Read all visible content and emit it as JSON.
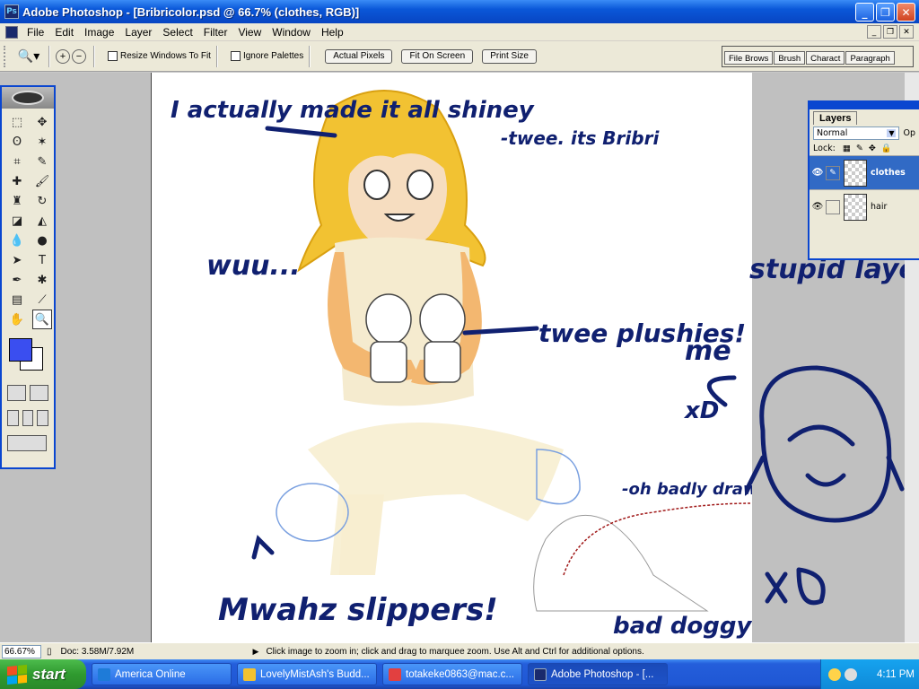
{
  "window": {
    "title": "Adobe Photoshop - [Bribricolor.psd @ 66.7% (clothes, RGB)]",
    "controls": [
      "minimize",
      "restore",
      "close"
    ]
  },
  "menu": {
    "items": [
      "File",
      "Edit",
      "Image",
      "Layer",
      "Select",
      "Filter",
      "View",
      "Window",
      "Help"
    ]
  },
  "options": {
    "resize_windows": "Resize Windows To Fit",
    "ignore_palettes": "Ignore Palettes",
    "actual_pixels": "Actual Pixels",
    "fit_on_screen": "Fit On Screen",
    "print_size": "Print Size",
    "palette_well": [
      "File Brows",
      "Brush",
      "Charact",
      "Paragraph"
    ]
  },
  "layers_palette": {
    "tab": "Layers",
    "blend_mode": "Normal",
    "opacity_label": "Op",
    "lock_label": "Lock:",
    "layers": [
      {
        "name": "clothes",
        "selected": true
      },
      {
        "name": "hair",
        "selected": false
      }
    ]
  },
  "canvas_notes": {
    "n1": "I actually made it all shiney",
    "n2": "wuu...",
    "n3": "-twee. its Bribri",
    "n4": "twee plushies!",
    "n5": "me",
    "n6": "stupid layers",
    "n7": "-oh badly drawn",
    "n8": "Mwahz slippers!",
    "n9": "bad doggy",
    "n10": "xD"
  },
  "status": {
    "zoom": "66.67%",
    "doc_size": "Doc: 3.58M/7.92M",
    "hint": "Click image to zoom in; click and drag to marquee zoom.  Use Alt and Ctrl for additional options."
  },
  "taskbar": {
    "start": "start",
    "tasks": [
      {
        "label": "America  Online",
        "color": "#1e7bd8"
      },
      {
        "label": "LovelyMistAsh's Budd...",
        "color": "#f2c230"
      },
      {
        "label": "totakeke0863@mac.c...",
        "color": "#e24040"
      },
      {
        "label": "Adobe Photoshop - [...",
        "color": "#1a2a6c"
      }
    ],
    "clock": "4:11 PM"
  },
  "colors": {
    "foreground": "#3a4ef0",
    "background": "#ffffff",
    "ink": "#102070"
  }
}
